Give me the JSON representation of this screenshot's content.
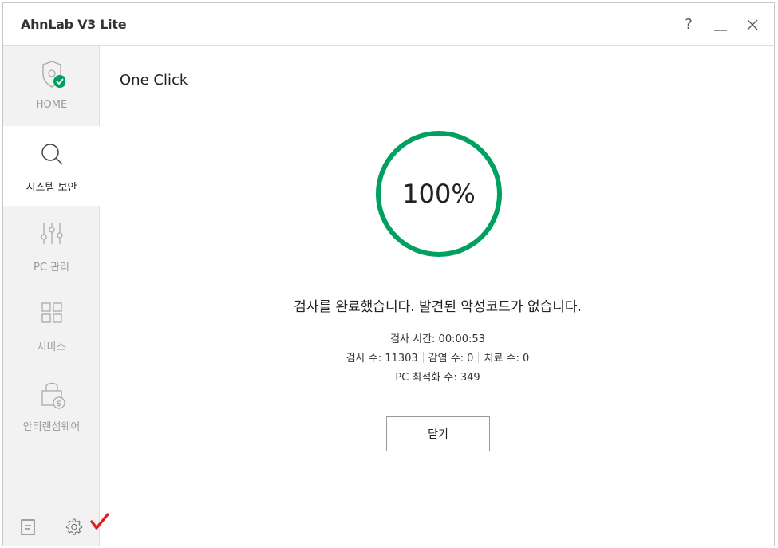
{
  "window": {
    "title": "AhnLab V3 Lite",
    "help_label": "?"
  },
  "sidebar": {
    "items": [
      {
        "label": "HOME",
        "icon": "shield-check-icon",
        "active": false
      },
      {
        "label": "시스템 보안",
        "icon": "search-icon",
        "active": true
      },
      {
        "label": "PC 관리",
        "icon": "sliders-icon",
        "active": false
      },
      {
        "label": "서비스",
        "icon": "grid-icon",
        "active": false
      },
      {
        "label": "안티랜섬웨어",
        "icon": "lock-dollar-icon",
        "active": false
      }
    ],
    "footer": {
      "left_icon": "document-icon",
      "right_icon": "gear-icon"
    }
  },
  "main": {
    "title": "One Click",
    "progress": {
      "value_text": "100%",
      "fraction": 1.0
    },
    "result_message": "검사를 완료했습니다. 발견된 악성코드가 없습니다.",
    "stats": {
      "scan_time": "검사 시간: 00:00:53",
      "scan_count": "검사 수: 11303",
      "infected_count": "감염 수: 0",
      "treated_count": "치료 수: 0",
      "optimize_count": "PC 최적화 수: 349"
    },
    "close_button_label": "닫기"
  },
  "colors": {
    "accent_green": "#00a160",
    "check_red": "#e0201c",
    "sidebar_bg": "#f2f2f2"
  }
}
